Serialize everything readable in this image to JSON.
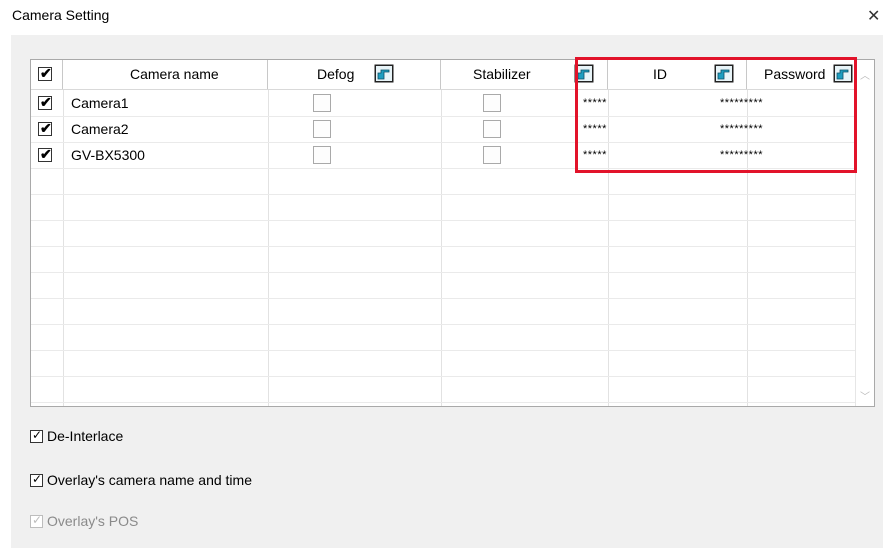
{
  "window": {
    "title": "Camera Setting",
    "close_glyph": "✕"
  },
  "table": {
    "headers": [
      "Camera name",
      "Defog",
      "Stabilizer",
      "ID",
      "Password"
    ],
    "rows": [
      {
        "checked": true,
        "name": "Camera1",
        "defog": false,
        "stabilizer": false,
        "id": "*****",
        "password": "*********"
      },
      {
        "checked": true,
        "name": "Camera2",
        "defog": false,
        "stabilizer": false,
        "id": "*****",
        "password": "*********"
      },
      {
        "checked": true,
        "name": "GV-BX5300",
        "defog": false,
        "stabilizer": false,
        "id": "*****",
        "password": "*********"
      }
    ],
    "highlight_color": "#e2132a"
  },
  "options": {
    "deinterlace": {
      "label": "De-Interlace",
      "checked": true,
      "enabled": true
    },
    "overlay_name_time": {
      "label": "Overlay's camera name and time",
      "checked": true,
      "enabled": true
    },
    "overlay_pos": {
      "label": "Overlay's POS",
      "checked": true,
      "enabled": false
    }
  },
  "icons": {
    "hand": "pointing-hand-icon",
    "check": "checkmark-icon"
  }
}
